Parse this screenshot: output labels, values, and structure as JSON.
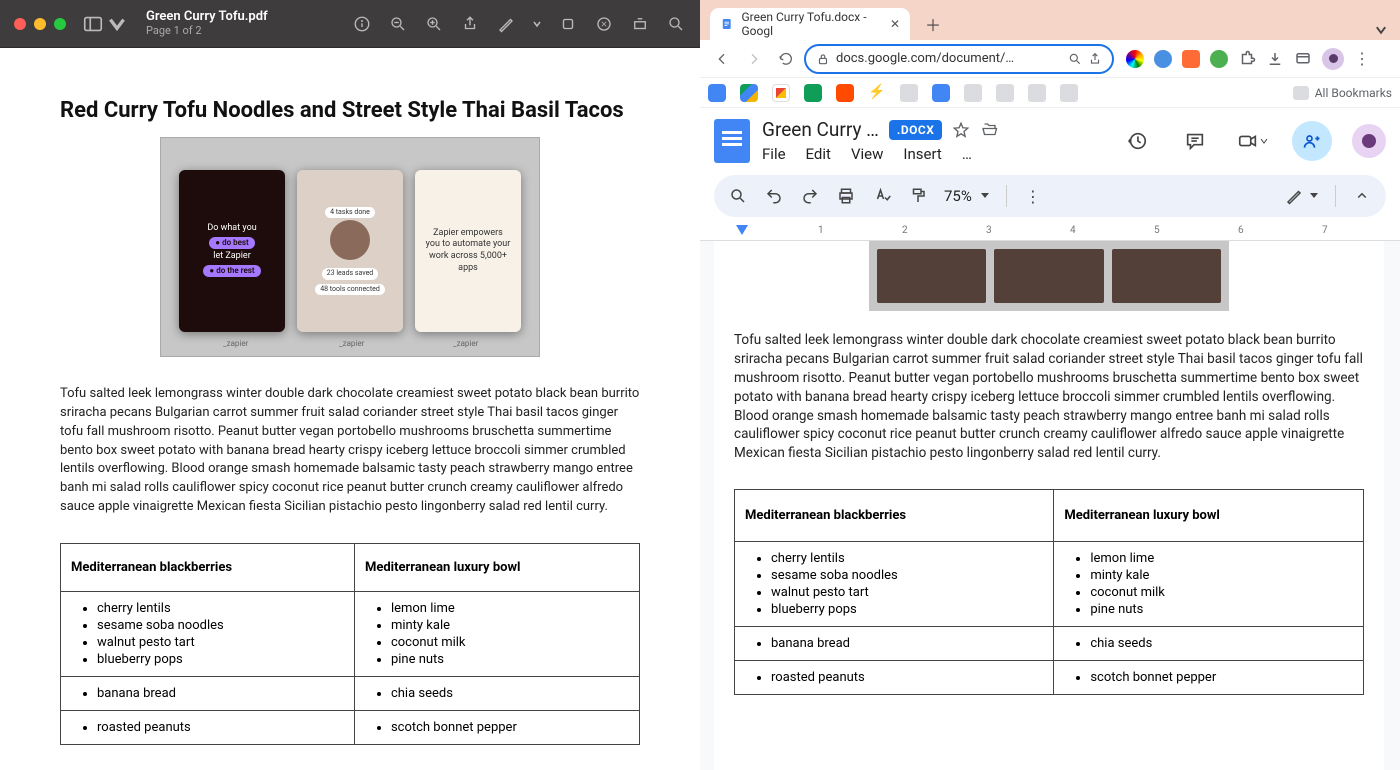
{
  "preview": {
    "title": "Green Curry Tofu.pdf",
    "subtitle": "Page 1 of 2"
  },
  "document": {
    "heading": "Red Curry Tofu Noodles and Street Style Thai Basil Tacos",
    "image_panels": {
      "left_line1": "Do what you",
      "left_pill1": "● do best",
      "left_line2": "let Zapier",
      "left_pill2": "● do the rest",
      "mid_chip1": "4 tasks done",
      "mid_chip2": "23 leads saved",
      "mid_chip3": "48 tools connected",
      "right_text": "Zapier empowers you to automate your work across 5,000+ apps",
      "logo": "_zapier"
    },
    "paragraph": "Tofu salted leek lemongrass winter double dark chocolate creamiest sweet potato black bean burrito sriracha pecans Bulgarian carrot summer fruit salad coriander street style Thai basil tacos ginger tofu fall mushroom risotto. Peanut butter vegan portobello mushrooms bruschetta summertime bento box sweet potato with banana bread hearty crispy iceberg lettuce broccoli simmer crumbled lentils overflowing. Blood orange smash homemade balsamic tasty peach strawberry mango entree banh mi salad rolls cauliflower spicy coconut rice peanut butter crunch creamy cauliflower alfredo sauce apple vinaigrette Mexican fiesta Sicilian pistachio pesto lingonberry salad red lentil curry.",
    "table": {
      "h1": "Mediterranean blackberries",
      "h2": "Mediterranean luxury bowl",
      "r1c1": [
        "cherry lentils",
        "sesame soba noodles",
        "walnut pesto tart",
        "blueberry pops"
      ],
      "r1c2": [
        "lemon lime",
        "minty kale",
        "coconut milk",
        "pine nuts"
      ],
      "r2c1": [
        "banana bread"
      ],
      "r2c2": [
        "chia seeds"
      ],
      "r3c1": [
        "roasted peanuts"
      ],
      "r3c2": [
        "scotch bonnet pepper"
      ]
    }
  },
  "chrome": {
    "tab_title": "Green Curry Tofu.docx - Googl",
    "url": "docs.google.com/document/…",
    "all_bookmarks": "All Bookmarks"
  },
  "gdoc": {
    "title": "Green Curry …",
    "badge": ".DOCX",
    "menus": [
      "File",
      "Edit",
      "View",
      "Insert",
      "…"
    ],
    "zoom": "75%",
    "ruler": [
      "1",
      "2",
      "3",
      "4",
      "5",
      "6",
      "7"
    ]
  }
}
